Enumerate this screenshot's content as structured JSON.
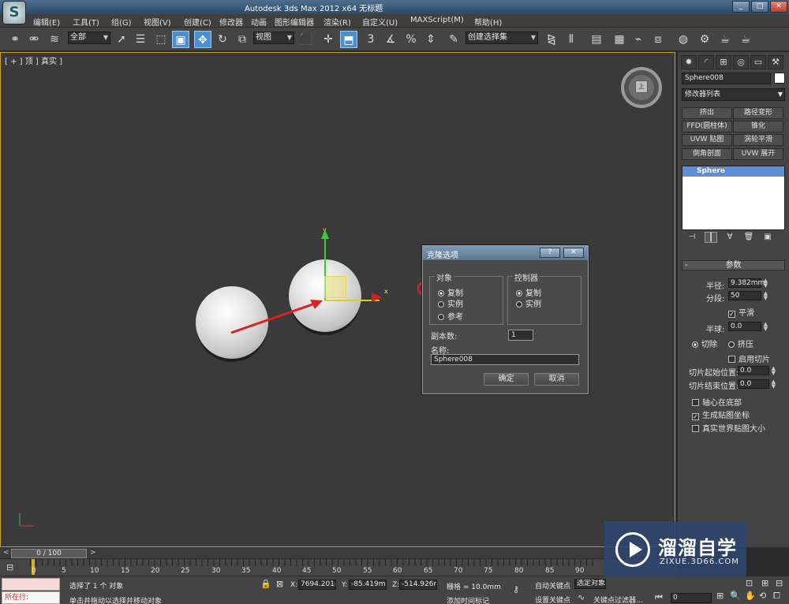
{
  "window": {
    "title": "Autodesk 3ds Max  2012 x64     无标题",
    "buttons": [
      "_",
      "□",
      "✕"
    ]
  },
  "menu": [
    "编辑(E)",
    "工具(T)",
    "组(G)",
    "视图(V)",
    "创建(C)",
    "修改器",
    "动画",
    "图形编辑器",
    "渲染(R)",
    "自定义(U)",
    "MAXScript(M)",
    "帮助(H)"
  ],
  "toolbar": {
    "selection_filter": "全部",
    "ref_coord": "视图",
    "named_selection": "创建选择集",
    "snaps_label": "3"
  },
  "viewport": {
    "label": "[ + ] 顶 ] 真实 ]",
    "gizmo_y": "y",
    "gizmo_x": "x"
  },
  "clone_dialog": {
    "title": "克隆选项",
    "help": "?",
    "close": "✕",
    "object_group": "对象",
    "object_options": [
      "复制",
      "实例",
      "参考"
    ],
    "object_selected": "复制",
    "controller_group": "控制器",
    "controller_options": [
      "复制",
      "实例"
    ],
    "controller_selected": "复制",
    "copies_label": "副本数:",
    "copies_value": "1",
    "name_label": "名称:",
    "name_value": "Sphere008",
    "ok": "确定",
    "cancel": "取消"
  },
  "command_panel": {
    "object_name": "Sphere008",
    "object_color": "#ffffff",
    "modifier_list": "修改器列表",
    "modifier_buttons": [
      "挤出",
      "路径变形",
      "FFD(圆柱体)",
      "锥化",
      "UVW 贴图",
      "涡轮平滑",
      "倒角剖面",
      "UVW 展开"
    ],
    "stack_items": [
      "Sphere"
    ],
    "rollout_title": "参数",
    "radius_label": "半径:",
    "radius_value": "9.382mm",
    "segments_label": "分段:",
    "segments_value": "50",
    "smooth_label": "平滑",
    "smooth_checked": true,
    "hemisphere_label": "半球:",
    "hemisphere_value": "0.0",
    "chop_label": "切除",
    "squash_label": "挤压",
    "chop_selected": true,
    "slice_on_label": "启用切片",
    "slice_from_label": "切片起始位置:",
    "slice_from_value": "0.0",
    "slice_to_label": "切片结束位置:",
    "slice_to_value": "0.0",
    "base_to_pivot_label": "轴心在底部",
    "gen_map_label": "生成贴图坐标",
    "gen_map_checked": true,
    "real_world_label": "真实世界贴图大小"
  },
  "timeline": {
    "slider": "0 / 100",
    "ticks": [
      "0",
      "5",
      "10",
      "15",
      "20",
      "25",
      "30",
      "35",
      "40",
      "45",
      "50",
      "55",
      "60",
      "65",
      "70",
      "75",
      "80",
      "85",
      "90"
    ]
  },
  "status": {
    "running_label": "所在行:",
    "selected": "选择了 1 个 对象",
    "prompt": "单击并拖动以选择并移动对象",
    "x_label": "X:",
    "x_value": "7694.201m",
    "y_label": "Y:",
    "y_value": "-85.419mm",
    "z_label": "Z:",
    "z_value": "-514.926m",
    "grid": "栅格 = 10.0mm",
    "add_time_tag": "添加时间标记",
    "auto_key": "自动关键点",
    "set_key": "设置关键点",
    "selected_object": "选定对象",
    "key_filters": "关键点过滤器...",
    "frame_value": "0"
  },
  "watermark": {
    "title": "溜溜自学",
    "subtitle": "ZIXUE.3D66.COM"
  },
  "colors": {
    "viewport_border": "#c8a12a",
    "annotation_red": "#e02020",
    "stack_selection": "#5d8ed8"
  }
}
